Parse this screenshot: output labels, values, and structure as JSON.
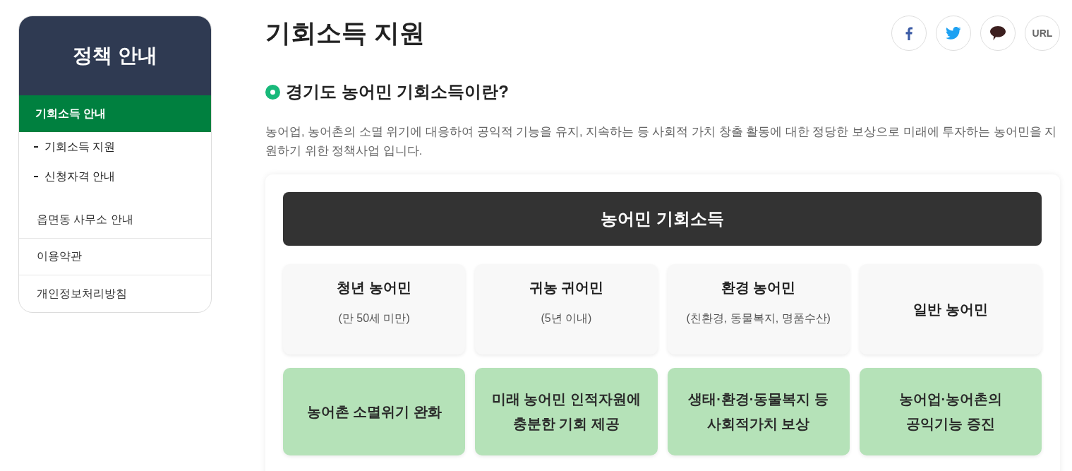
{
  "sidebar": {
    "title": "정책 안내",
    "items": [
      {
        "label": "기회소득 안내",
        "selected": true,
        "children": [
          {
            "label": "기회소득 지원",
            "selected": false
          },
          {
            "label": "신청자격 안내",
            "selected": false
          }
        ]
      },
      {
        "label": "읍면동 사무소 안내",
        "selected": false
      },
      {
        "label": "이용약관",
        "selected": false
      },
      {
        "label": "개인정보처리방침",
        "selected": false
      }
    ]
  },
  "page_title": "기회소득 지원",
  "share_buttons": [
    {
      "kind": "facebook"
    },
    {
      "kind": "twitter"
    },
    {
      "kind": "talk"
    },
    {
      "kind": "url",
      "label": "URL"
    }
  ],
  "section": {
    "heading": "경기도 농어민 기회소득이란?",
    "paragraph": "농어업, 농어촌의 소멸 위기에 대응하여 공익적 기능을 유지, 지속하는 등 사회적 가치 창출 활동에 대한 정당한 보상으로 미래에 투자하는 농어민을 지원하기 위한 정책사업 입니다."
  },
  "info_card": {
    "banner": "농어민 기회소득",
    "groups": [
      {
        "title": "청년 농어민",
        "note": "(만 50세 미만)"
      },
      {
        "title": "귀농 귀어민",
        "note": "(5년 이내)"
      },
      {
        "title": "환경 농어민",
        "note": "(친환경, 동물복지, 명품수산)"
      },
      {
        "title": "일반 농어민"
      }
    ],
    "goals": [
      "농어촌 소멸위기 완화",
      "미래 농어민 인적자원에\n충분한 기회 제공",
      "생태·환경·동물복지 등\n사회적가치 보상",
      "농어업·농어촌의\n공익기능 증진"
    ]
  }
}
